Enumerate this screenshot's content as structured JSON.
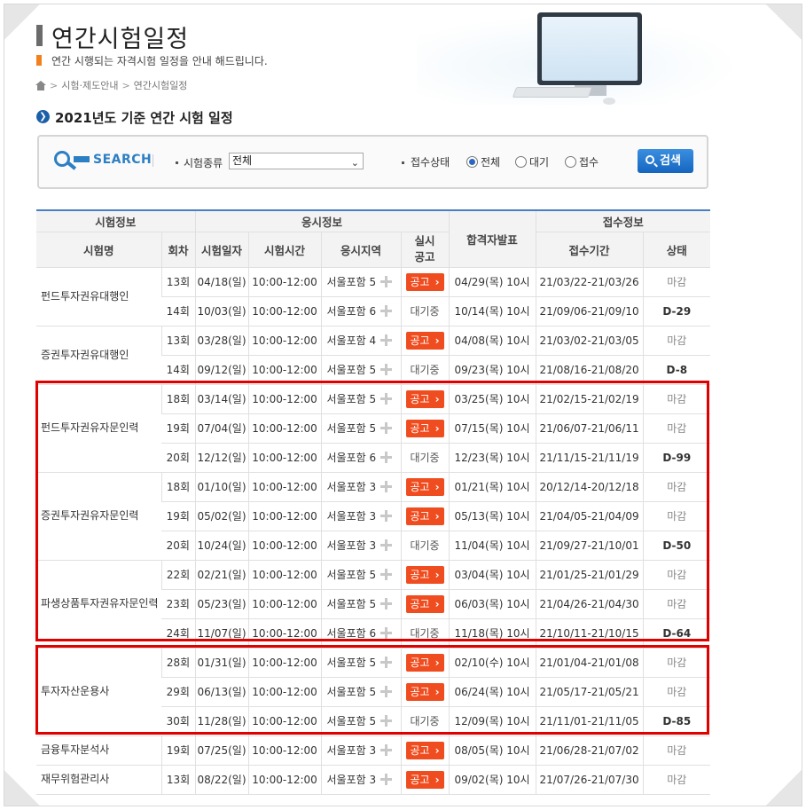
{
  "header": {
    "title": "연간시험일정",
    "subtitle": "연간 시행되는 자격시험 일정을 안내 해드립니다.",
    "breadcrumb": [
      "시험·제도안내",
      "연간시험일정"
    ]
  },
  "section_title": "2021년도 기준 연간 시험 일정",
  "search": {
    "logo_text": "SEARCH",
    "exam_type_label": "시험종류",
    "exam_type_value": "전체",
    "status_label": "접수상태",
    "status_options": [
      "전체",
      "대기",
      "접수"
    ],
    "status_selected": "전체",
    "button_label": "검색"
  },
  "table": {
    "group_headers": {
      "exam_info": "시험정보",
      "test_info": "응시정보",
      "result": "합격자발표",
      "receipt_info": "접수정보"
    },
    "columns": {
      "name": "시험명",
      "round": "회차",
      "date": "시험일자",
      "time": "시험시간",
      "region": "응시지역",
      "notice": "실시\n공고",
      "period": "접수기간",
      "status": "상태"
    },
    "notice_label": "공고",
    "groups": [
      {
        "name": "펀드투자권유대행인",
        "rows": [
          {
            "round": "13회",
            "date": "04/18(일)",
            "time": "10:00-12:00",
            "region": "서울포함 5",
            "notice": "공고",
            "result": "04/29(목) 10시",
            "period": "21/03/22-21/03/26",
            "status": "마감"
          },
          {
            "round": "14회",
            "date": "10/03(일)",
            "time": "10:00-12:00",
            "region": "서울포함 6",
            "notice": "대기중",
            "result": "10/14(목) 10시",
            "period": "21/09/06-21/09/10",
            "status": "D-29"
          }
        ]
      },
      {
        "name": "증권투자권유대행인",
        "rows": [
          {
            "round": "13회",
            "date": "03/28(일)",
            "time": "10:00-12:00",
            "region": "서울포함 4",
            "notice": "공고",
            "result": "04/08(목) 10시",
            "period": "21/03/02-21/03/05",
            "status": "마감"
          },
          {
            "round": "14회",
            "date": "09/12(일)",
            "time": "10:00-12:00",
            "region": "서울포함 5",
            "notice": "대기중",
            "result": "09/23(목) 10시",
            "period": "21/08/16-21/08/20",
            "status": "D-8"
          }
        ]
      },
      {
        "name": "펀드투자권유자문인력",
        "rows": [
          {
            "round": "18회",
            "date": "03/14(일)",
            "time": "10:00-12:00",
            "region": "서울포함 5",
            "notice": "공고",
            "result": "03/25(목) 10시",
            "period": "21/02/15-21/02/19",
            "status": "마감"
          },
          {
            "round": "19회",
            "date": "07/04(일)",
            "time": "10:00-12:00",
            "region": "서울포함 5",
            "notice": "공고",
            "result": "07/15(목) 10시",
            "period": "21/06/07-21/06/11",
            "status": "마감"
          },
          {
            "round": "20회",
            "date": "12/12(일)",
            "time": "10:00-12:00",
            "region": "서울포함 6",
            "notice": "대기중",
            "result": "12/23(목) 10시",
            "period": "21/11/15-21/11/19",
            "status": "D-99"
          }
        ]
      },
      {
        "name": "증권투자권유자문인력",
        "rows": [
          {
            "round": "18회",
            "date": "01/10(일)",
            "time": "10:00-12:00",
            "region": "서울포함 3",
            "notice": "공고",
            "result": "01/21(목) 10시",
            "period": "20/12/14-20/12/18",
            "status": "마감"
          },
          {
            "round": "19회",
            "date": "05/02(일)",
            "time": "10:00-12:00",
            "region": "서울포함 3",
            "notice": "공고",
            "result": "05/13(목) 10시",
            "period": "21/04/05-21/04/09",
            "status": "마감"
          },
          {
            "round": "20회",
            "date": "10/24(일)",
            "time": "10:00-12:00",
            "region": "서울포함 3",
            "notice": "대기중",
            "result": "11/04(목) 10시",
            "period": "21/09/27-21/10/01",
            "status": "D-50"
          }
        ]
      },
      {
        "name": "파생상품투자권유자문인력",
        "rows": [
          {
            "round": "22회",
            "date": "02/21(일)",
            "time": "10:00-12:00",
            "region": "서울포함 5",
            "notice": "공고",
            "result": "03/04(목) 10시",
            "period": "21/01/25-21/01/29",
            "status": "마감"
          },
          {
            "round": "23회",
            "date": "05/23(일)",
            "time": "10:00-12:00",
            "region": "서울포함 5",
            "notice": "공고",
            "result": "06/03(목) 10시",
            "period": "21/04/26-21/04/30",
            "status": "마감"
          },
          {
            "round": "24회",
            "date": "11/07(일)",
            "time": "10:00-12:00",
            "region": "서울포함 6",
            "notice": "대기중",
            "result": "11/18(목) 10시",
            "period": "21/10/11-21/10/15",
            "status": "D-64"
          }
        ]
      },
      {
        "name": "투자자산운용사",
        "rows": [
          {
            "round": "28회",
            "date": "01/31(일)",
            "time": "10:00-12:00",
            "region": "서울포함 5",
            "notice": "공고",
            "result": "02/10(수) 10시",
            "period": "21/01/04-21/01/08",
            "status": "마감"
          },
          {
            "round": "29회",
            "date": "06/13(일)",
            "time": "10:00-12:00",
            "region": "서울포함 5",
            "notice": "공고",
            "result": "06/24(목) 10시",
            "period": "21/05/17-21/05/21",
            "status": "마감"
          },
          {
            "round": "30회",
            "date": "11/28(일)",
            "time": "10:00-12:00",
            "region": "서울포함 5",
            "notice": "대기중",
            "result": "12/09(목) 10시",
            "period": "21/11/01-21/11/05",
            "status": "D-85"
          }
        ]
      },
      {
        "name": "금융투자분석사",
        "rows": [
          {
            "round": "19회",
            "date": "07/25(일)",
            "time": "10:00-12:00",
            "region": "서울포함 3",
            "notice": "공고",
            "result": "08/05(목) 10시",
            "period": "21/06/28-21/07/02",
            "status": "마감"
          }
        ]
      },
      {
        "name": "재무위험관리사",
        "rows": [
          {
            "round": "13회",
            "date": "08/22(일)",
            "time": "10:00-12:00",
            "region": "서울포함 3",
            "notice": "공고",
            "result": "09/02(목) 10시",
            "period": "21/07/26-21/07/30",
            "status": "마감"
          }
        ]
      }
    ]
  },
  "colors": {
    "accent_blue": "#1a5fa8",
    "notice_button": "#ef4c1f",
    "highlight": "#e00000"
  }
}
